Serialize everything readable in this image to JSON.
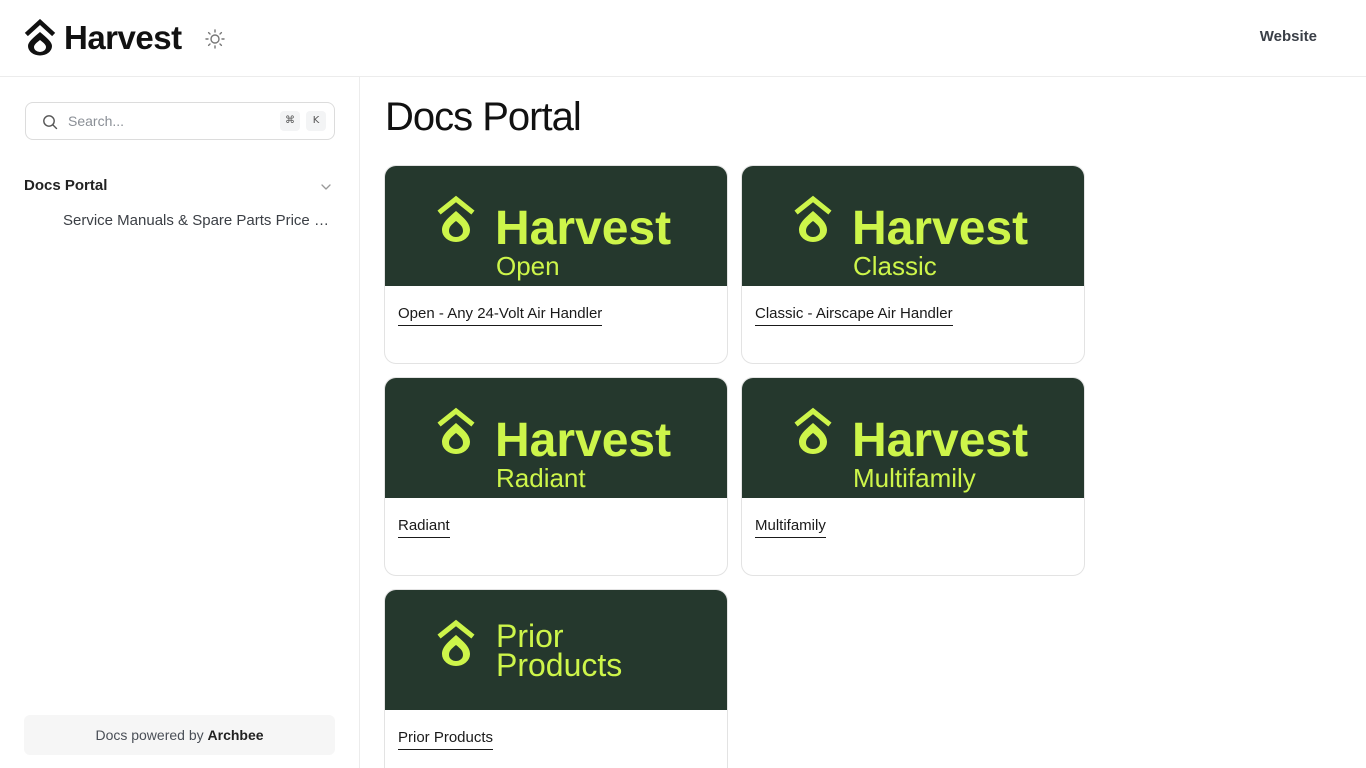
{
  "header": {
    "brand": "Harvest",
    "website_label": "Website"
  },
  "search": {
    "placeholder": "Search...",
    "shortcut_cmd": "⌘",
    "shortcut_key": "K"
  },
  "sidebar": {
    "section_label": "Docs Portal",
    "items": [
      {
        "label": "Service Manuals & Spare Parts Price List"
      }
    ],
    "powered_prefix": "Docs powered by ",
    "powered_brand": "Archbee"
  },
  "main": {
    "title": "Docs Portal",
    "cards": [
      {
        "banner_brand": "Harvest",
        "banner_sub": "Open",
        "title": "Open -  Any 24-Volt Air Handler"
      },
      {
        "banner_brand": "Harvest",
        "banner_sub": "Classic",
        "title": "Classic - Airscape Air Handler"
      },
      {
        "banner_brand": "Harvest",
        "banner_sub": "Radiant",
        "title": "Radiant"
      },
      {
        "banner_brand": "Harvest",
        "banner_sub": "Multifamily",
        "title": "Multifamily"
      },
      {
        "banner_line1": "Prior",
        "banner_line2": "Products",
        "title": "Prior Products"
      }
    ]
  },
  "colors": {
    "banner_bg": "#25382d",
    "banner_accent": "#cdf54a",
    "text_dark": "#111111"
  },
  "icons": {
    "logo": "harvest-drop-logo-icon",
    "theme": "sun-icon",
    "search": "search-icon",
    "chevron": "chevron-down-icon"
  }
}
